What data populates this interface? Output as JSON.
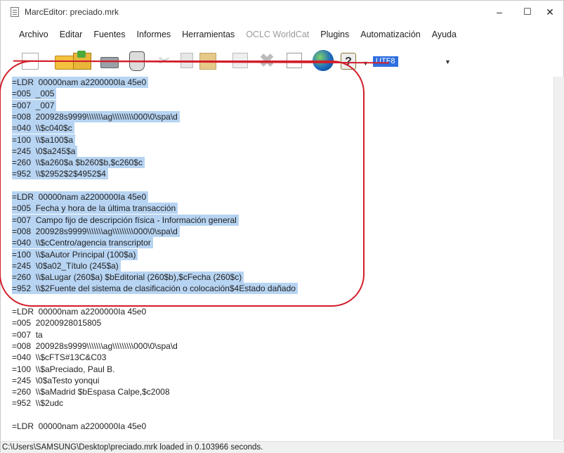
{
  "window": {
    "title": "MarcEditor: preciado.mrk",
    "minimize": "–",
    "maximize": "☐",
    "close": "✕"
  },
  "menu": [
    "Archivo",
    "Editar",
    "Fuentes",
    "Informes",
    "Herramientas",
    "OCLC WorldCat",
    "Plugins",
    "Automatización",
    "Ayuda"
  ],
  "toolbar": {
    "encoding": "UTF8",
    "icons": [
      "new-file-icon",
      "open-folder-icon",
      "save-icon",
      "print-icon",
      "filter-icon",
      "cut-icon",
      "copy-icon",
      "paste-icon",
      "insert-icon",
      "delete-icon",
      "find-icon",
      "globe-icon",
      "help-icon"
    ]
  },
  "editor": {
    "lines": [
      {
        "text": "=LDR  00000nam a2200000Ia 45e0",
        "selected": true
      },
      {
        "text": "=005  _005",
        "selected": true
      },
      {
        "text": "=007  _007",
        "selected": true
      },
      {
        "text": "=008  200928s9999\\\\\\\\\\\\\\ag\\\\\\\\\\\\\\\\\\000\\0\\spa\\d",
        "selected": true
      },
      {
        "text": "=040  \\\\$c040$c",
        "selected": true
      },
      {
        "text": "=100  \\\\$a100$a",
        "selected": true
      },
      {
        "text": "=245  \\0$a245$a",
        "selected": true
      },
      {
        "text": "=260  \\\\$a260$a $b260$b,$c260$c",
        "selected": true
      },
      {
        "text": "=952  \\\\$2952$2$4952$4",
        "selected": true
      },
      {
        "text": "",
        "selected": true
      },
      {
        "text": "=LDR  00000nam a2200000Ia 45e0",
        "selected": true
      },
      {
        "text": "=005  Fecha y hora de la última transacción",
        "selected": true
      },
      {
        "text": "=007  Campo fijo de descripción física - Información general",
        "selected": true
      },
      {
        "text": "=008  200928s9999\\\\\\\\\\\\\\ag\\\\\\\\\\\\\\\\\\000\\0\\spa\\d",
        "selected": true
      },
      {
        "text": "=040  \\\\$cCentro/agencia transcriptor",
        "selected": true
      },
      {
        "text": "=100  \\\\$aAutor Principal (100$a)",
        "selected": true
      },
      {
        "text": "=245  \\0$a02_Título (245$a)",
        "selected": true
      },
      {
        "text": "=260  \\\\$aLugar (260$a) $bEditorial (260$b),$cFecha (260$c)",
        "selected": true
      },
      {
        "text": "=952  \\\\$2Fuente del sistema de clasificación o colocación$4Estado dañado",
        "selected": true
      },
      {
        "text": "",
        "selected": false
      },
      {
        "text": "=LDR  00000nam a2200000Ia 45e0",
        "selected": false
      },
      {
        "text": "=005  20200928015805",
        "selected": false
      },
      {
        "text": "=007  ta",
        "selected": false
      },
      {
        "text": "=008  200928s9999\\\\\\\\\\\\\\ag\\\\\\\\\\\\\\\\\\000\\0\\spa\\d",
        "selected": false
      },
      {
        "text": "=040  \\\\$cFTS#13C&C03",
        "selected": false
      },
      {
        "text": "=100  \\\\$aPreciado, Paul B.",
        "selected": false
      },
      {
        "text": "=245  \\0$aTesto yonqui",
        "selected": false
      },
      {
        "text": "=260  \\\\$aMadrid $bEspasa Calpe,$c2008",
        "selected": false
      },
      {
        "text": "=952  \\\\$2udc",
        "selected": false
      },
      {
        "text": "",
        "selected": false
      },
      {
        "text": "=LDR  00000nam a2200000Ia 45e0",
        "selected": false
      }
    ]
  },
  "status": {
    "text": "C:\\Users\\SAMSUNG\\Desktop\\preciado.mrk loaded in 0.103966 seconds."
  },
  "annotation": {
    "color": "#d21e2a"
  }
}
